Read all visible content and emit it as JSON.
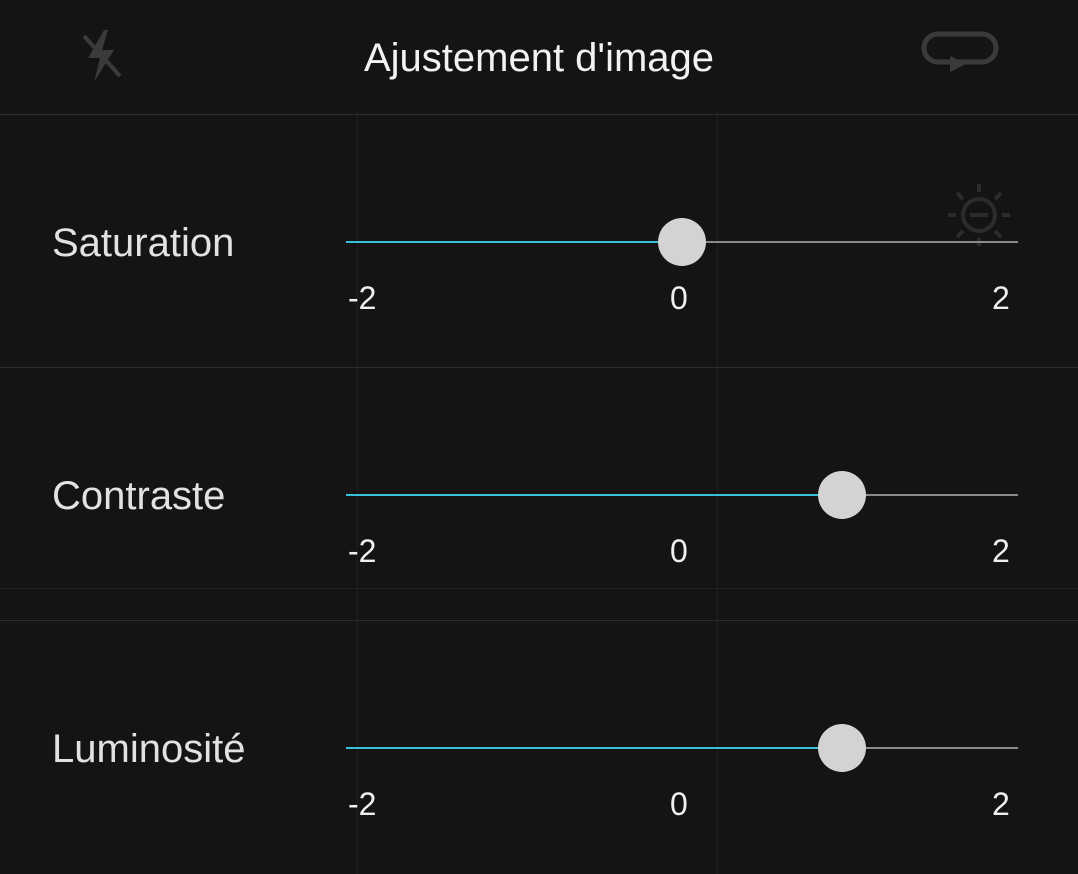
{
  "header": {
    "title": "Ajustement d'image",
    "left_icon": "flash-off-icon",
    "right_icon": "switch-camera-icon"
  },
  "overlay_icon": "brightness-minus-icon",
  "colors": {
    "background": "#141414",
    "accent": "#35c2d6",
    "thumb": "#d3d3d3",
    "track": "#8a8a8a"
  },
  "sliders": [
    {
      "label": "Saturation",
      "min": -2,
      "max": 2,
      "value": 0,
      "min_label": "-2",
      "mid_label": "0",
      "max_label": "2"
    },
    {
      "label": "Contraste",
      "min": -2,
      "max": 2,
      "value": 1,
      "min_label": "-2",
      "mid_label": "0",
      "max_label": "2"
    },
    {
      "label": "Luminosité",
      "min": -2,
      "max": 2,
      "value": 1,
      "min_label": "-2",
      "mid_label": "0",
      "max_label": "2"
    }
  ]
}
